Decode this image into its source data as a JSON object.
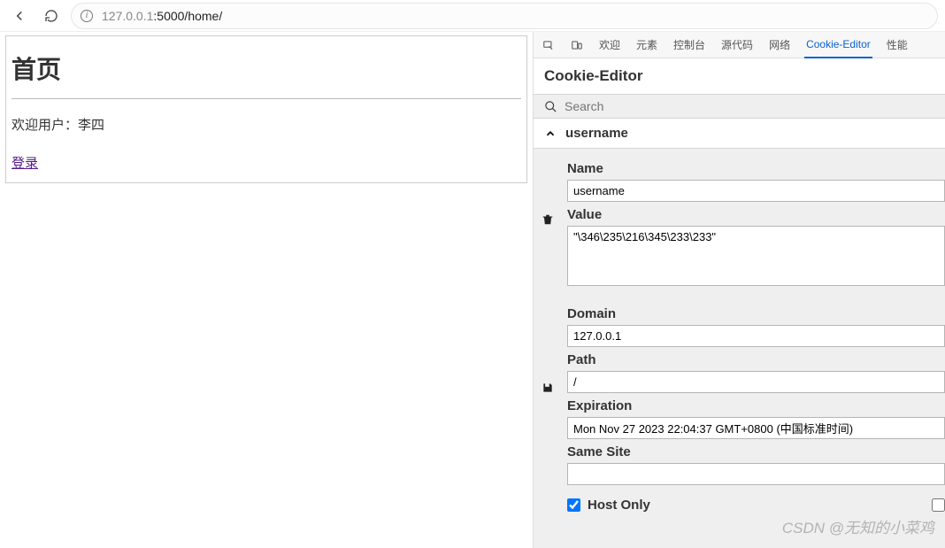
{
  "browser": {
    "url_dim_prefix": "127.0.0.1",
    "url_rest": ":5000/home/"
  },
  "page": {
    "title": "首页",
    "welcome_text": "欢迎用户：李四",
    "login_link": "登录"
  },
  "devtools": {
    "tabs": {
      "welcome": "欢迎",
      "elements": "元素",
      "console": "控制台",
      "sources": "源代码",
      "network": "网络",
      "cookie_editor": "Cookie-Editor",
      "performance": "性能"
    },
    "panel_title": "Cookie-Editor",
    "search_placeholder": "Search"
  },
  "cookie": {
    "item_name": "username",
    "labels": {
      "name": "Name",
      "value": "Value",
      "domain": "Domain",
      "path": "Path",
      "expiration": "Expiration",
      "same_site": "Same Site",
      "host_only": "Host Only"
    },
    "fields": {
      "name": "username",
      "value": "\"\\346\\235\\216\\345\\233\\233\"",
      "domain": "127.0.0.1",
      "path": "/",
      "expiration": "Mon Nov 27 2023 22:04:37 GMT+0800 (中国标准时间)",
      "same_site": ""
    },
    "host_only_checked": true
  },
  "watermark": "CSDN @无知的小菜鸡"
}
